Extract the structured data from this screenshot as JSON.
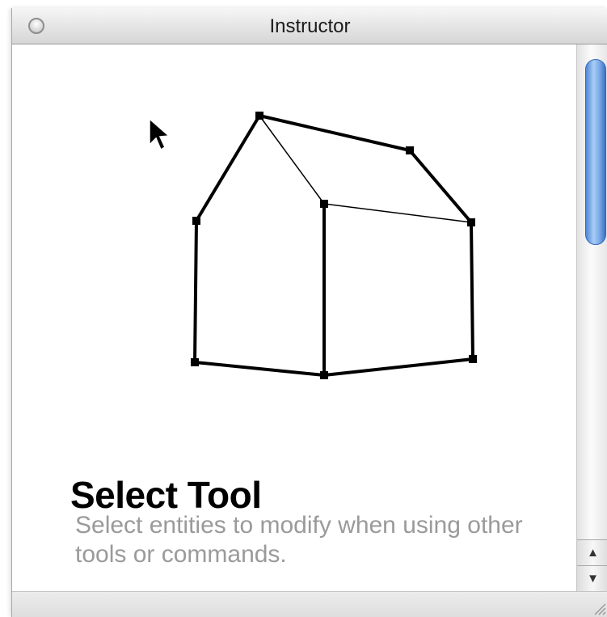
{
  "window": {
    "title": "Instructor"
  },
  "icons": {
    "close": "close-button-icon",
    "cursor": "arrow-cursor-icon",
    "scroll_up": "scroll-up-arrow-icon",
    "scroll_down": "scroll-down-arrow-icon",
    "resize": "resize-grip-icon",
    "illustration": "house-wireframe-illustration"
  },
  "tool": {
    "name": "Select Tool",
    "description": "Select entities to modify when using other tools or commands."
  },
  "scroll": {
    "up_glyph": "▲",
    "down_glyph": "▼"
  },
  "colors": {
    "scroll_thumb": "#5b93dd",
    "description_text": "#9a9a9a"
  }
}
